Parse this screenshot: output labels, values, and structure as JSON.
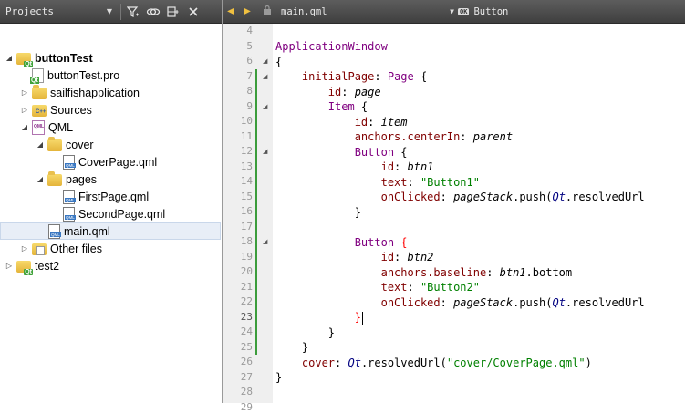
{
  "projects_panel": {
    "title": "Projects",
    "toolbar_icons": [
      "filter-icon",
      "link-icon",
      "split-icon",
      "close-icon"
    ],
    "tree": [
      {
        "label": "buttonTest",
        "kind": "project",
        "depth": 0,
        "expanded": true,
        "bold": true
      },
      {
        "label": "buttonTest.pro",
        "kind": "pro",
        "depth": 1,
        "expanded": null
      },
      {
        "label": "sailfishapplication",
        "kind": "folder",
        "depth": 1,
        "expanded": false
      },
      {
        "label": "Sources",
        "kind": "sources",
        "depth": 1,
        "expanded": false
      },
      {
        "label": "QML",
        "kind": "qml",
        "depth": 1,
        "expanded": true
      },
      {
        "label": "cover",
        "kind": "folder",
        "depth": 2,
        "expanded": true
      },
      {
        "label": "CoverPage.qml",
        "kind": "qmlfile",
        "depth": 3,
        "expanded": null
      },
      {
        "label": "pages",
        "kind": "folder",
        "depth": 2,
        "expanded": true
      },
      {
        "label": "FirstPage.qml",
        "kind": "qmlfile",
        "depth": 3,
        "expanded": null
      },
      {
        "label": "SecondPage.qml",
        "kind": "qmlfile",
        "depth": 3,
        "expanded": null
      },
      {
        "label": "main.qml",
        "kind": "qmlfile",
        "depth": 2,
        "expanded": null,
        "selected": true
      },
      {
        "label": "Other files",
        "kind": "other",
        "depth": 1,
        "expanded": false
      },
      {
        "label": "test2",
        "kind": "project",
        "depth": 0,
        "expanded": false
      }
    ]
  },
  "editor": {
    "file_name": "main.qml",
    "symbol": "Button",
    "current_line": 23,
    "lines": [
      {
        "n": 4,
        "code": []
      },
      {
        "n": 5,
        "code": [
          [
            "t-type",
            "ApplicationWindow"
          ]
        ]
      },
      {
        "n": 6,
        "fold": true,
        "code": [
          [
            "t-plain",
            "{"
          ]
        ]
      },
      {
        "n": 7,
        "fold": true,
        "code": [
          [
            "t-plain",
            "    "
          ],
          [
            "t-prop",
            "initialPage"
          ],
          [
            "t-plain",
            ": "
          ],
          [
            "t-type",
            "Page"
          ],
          [
            "t-plain",
            " {"
          ]
        ]
      },
      {
        "n": 8,
        "code": [
          [
            "t-plain",
            "        "
          ],
          [
            "t-prop",
            "id"
          ],
          [
            "t-plain",
            ": "
          ],
          [
            "t-id",
            "page"
          ]
        ]
      },
      {
        "n": 9,
        "fold": true,
        "code": [
          [
            "t-plain",
            "        "
          ],
          [
            "t-type",
            "Item"
          ],
          [
            "t-plain",
            " {"
          ]
        ]
      },
      {
        "n": 10,
        "code": [
          [
            "t-plain",
            "            "
          ],
          [
            "t-prop",
            "id"
          ],
          [
            "t-plain",
            ": "
          ],
          [
            "t-id",
            "item"
          ]
        ]
      },
      {
        "n": 11,
        "code": [
          [
            "t-plain",
            "            "
          ],
          [
            "t-prop",
            "anchors.centerIn"
          ],
          [
            "t-plain",
            ": "
          ],
          [
            "t-id",
            "parent"
          ]
        ]
      },
      {
        "n": 12,
        "fold": true,
        "code": [
          [
            "t-plain",
            "            "
          ],
          [
            "t-type",
            "Button"
          ],
          [
            "t-plain",
            " {"
          ]
        ]
      },
      {
        "n": 13,
        "code": [
          [
            "t-plain",
            "                "
          ],
          [
            "t-prop",
            "id"
          ],
          [
            "t-plain",
            ": "
          ],
          [
            "t-id",
            "btn1"
          ]
        ]
      },
      {
        "n": 14,
        "code": [
          [
            "t-plain",
            "                "
          ],
          [
            "t-prop",
            "text"
          ],
          [
            "t-plain",
            ": "
          ],
          [
            "t-str",
            "\"Button1\""
          ]
        ]
      },
      {
        "n": 15,
        "code": [
          [
            "t-plain",
            "                "
          ],
          [
            "t-prop",
            "onClicked"
          ],
          [
            "t-plain",
            ": "
          ],
          [
            "t-id",
            "pageStack"
          ],
          [
            "t-plain",
            ".push("
          ],
          [
            "t-qt",
            "Qt"
          ],
          [
            "t-plain",
            ".resolvedUrl"
          ]
        ]
      },
      {
        "n": 16,
        "code": [
          [
            "t-plain",
            "            }"
          ]
        ]
      },
      {
        "n": 17,
        "code": []
      },
      {
        "n": 18,
        "fold": true,
        "code": [
          [
            "t-plain",
            "            "
          ],
          [
            "t-type",
            "Button"
          ],
          [
            "t-plain",
            " "
          ],
          [
            "t-brace-red",
            "{"
          ]
        ]
      },
      {
        "n": 19,
        "code": [
          [
            "t-plain",
            "                "
          ],
          [
            "t-prop",
            "id"
          ],
          [
            "t-plain",
            ": "
          ],
          [
            "t-id",
            "btn2"
          ]
        ]
      },
      {
        "n": 20,
        "code": [
          [
            "t-plain",
            "                "
          ],
          [
            "t-prop",
            "anchors.baseline"
          ],
          [
            "t-plain",
            ": "
          ],
          [
            "t-id",
            "btn1"
          ],
          [
            "t-plain",
            ".bottom"
          ]
        ]
      },
      {
        "n": 21,
        "code": [
          [
            "t-plain",
            "                "
          ],
          [
            "t-prop",
            "text"
          ],
          [
            "t-plain",
            ": "
          ],
          [
            "t-str",
            "\"Button2\""
          ]
        ]
      },
      {
        "n": 22,
        "code": [
          [
            "t-plain",
            "                "
          ],
          [
            "t-prop",
            "onClicked"
          ],
          [
            "t-plain",
            ": "
          ],
          [
            "t-id",
            "pageStack"
          ],
          [
            "t-plain",
            ".push("
          ],
          [
            "t-qt",
            "Qt"
          ],
          [
            "t-plain",
            ".resolvedUrl"
          ]
        ]
      },
      {
        "n": 23,
        "cursor": true,
        "code": [
          [
            "t-plain",
            "            "
          ],
          [
            "t-brace-red",
            "}"
          ]
        ]
      },
      {
        "n": 24,
        "code": [
          [
            "t-plain",
            "        }"
          ]
        ]
      },
      {
        "n": 25,
        "code": [
          [
            "t-plain",
            "    }"
          ]
        ]
      },
      {
        "n": 26,
        "code": [
          [
            "t-plain",
            "    "
          ],
          [
            "t-prop",
            "cover"
          ],
          [
            "t-plain",
            ": "
          ],
          [
            "t-qt",
            "Qt"
          ],
          [
            "t-plain",
            ".resolvedUrl("
          ],
          [
            "t-str",
            "\"cover/CoverPage.qml\""
          ],
          [
            "t-plain",
            ")"
          ]
        ]
      },
      {
        "n": 27,
        "code": [
          [
            "t-plain",
            "}"
          ]
        ]
      },
      {
        "n": 28,
        "code": []
      },
      {
        "n": 29,
        "code": []
      }
    ]
  }
}
